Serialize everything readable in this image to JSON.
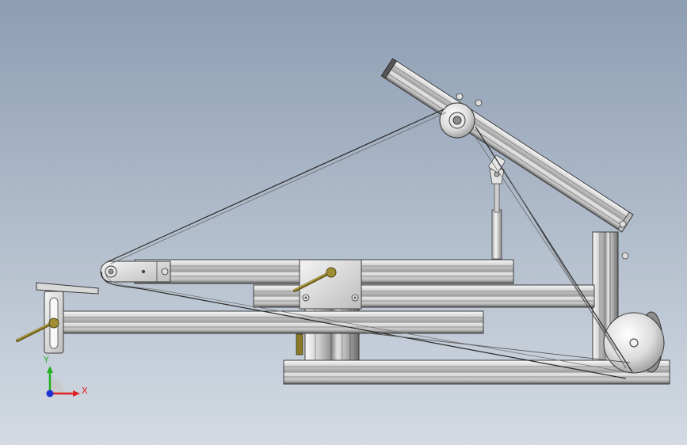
{
  "viewport": {
    "background_top": "#8d9db3",
    "background_bottom": "#d3dae3"
  },
  "triad": {
    "x_label": "X",
    "y_label": "Y",
    "x_color": "#e02020",
    "y_color": "#20b020",
    "z_color": "#2030d0"
  },
  "colors": {
    "aluminum_light": "#f2f2f2",
    "aluminum_mid": "#c9c9c9",
    "aluminum_dark": "#6e6e6e",
    "cable": "#2a2a2a",
    "handle_brass": "#8a7a2a"
  }
}
